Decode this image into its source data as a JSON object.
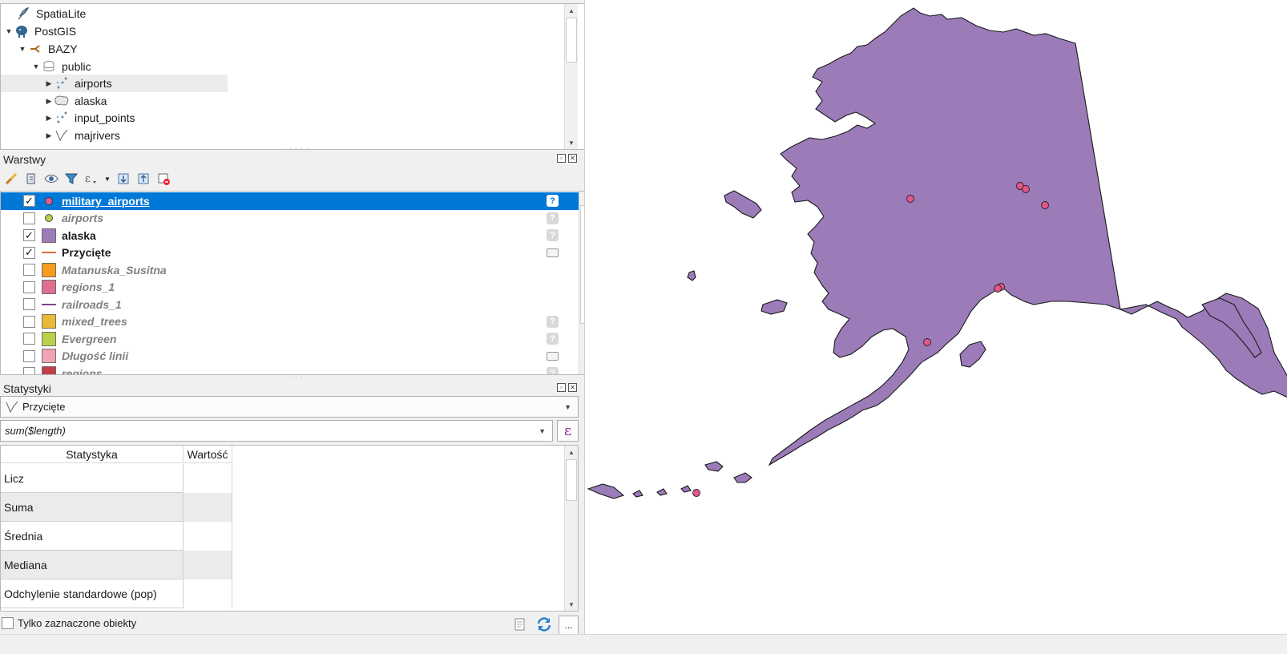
{
  "browser": {
    "items": [
      {
        "label": "SpatiaLite",
        "icon": "feather-icon"
      },
      {
        "label": "PostGIS",
        "icon": "elephant-icon"
      },
      {
        "label": "BAZY",
        "icon": "connection-icon"
      },
      {
        "label": "public",
        "icon": "database-schema-icon"
      },
      {
        "label": "airports",
        "icon": "point-layer-icon"
      },
      {
        "label": "alaska",
        "icon": "polygon-layer-icon"
      },
      {
        "label": "input_points",
        "icon": "point-layer-icon"
      },
      {
        "label": "majrivers",
        "icon": "line-layer-icon"
      }
    ]
  },
  "layers_panel": {
    "title": "Warstwy",
    "layers": [
      {
        "name": "military_airports",
        "checked": true,
        "symbol": "point",
        "color": "#e0578a",
        "visible": true,
        "indicator": "unknown-crs"
      },
      {
        "name": "airports",
        "checked": false,
        "symbol": "point",
        "color": "#b5d04a",
        "visible": false,
        "indicator": "unknown-crs"
      },
      {
        "name": "alaska",
        "checked": true,
        "symbol": "fill",
        "color": "#9b7bb8",
        "visible": true,
        "indicator": "unknown-crs"
      },
      {
        "name": "Przycięte",
        "checked": true,
        "symbol": "line",
        "color": "#e26a3a",
        "visible": true,
        "indicator": "memory"
      },
      {
        "name": "Matanuska_Susitna",
        "checked": false,
        "symbol": "fill",
        "color": "#f39c1e",
        "visible": false,
        "indicator": ""
      },
      {
        "name": "regions_1",
        "checked": false,
        "symbol": "fill",
        "color": "#e0708f",
        "visible": false,
        "indicator": ""
      },
      {
        "name": "railroads_1",
        "checked": false,
        "symbol": "line",
        "color": "#7b4a8c",
        "visible": false,
        "indicator": ""
      },
      {
        "name": "mixed_trees",
        "checked": false,
        "symbol": "fill",
        "color": "#e8b93a",
        "visible": false,
        "indicator": "unknown-crs"
      },
      {
        "name": "Evergreen",
        "checked": false,
        "symbol": "fill",
        "color": "#b7d24a",
        "visible": false,
        "indicator": "unknown-crs"
      },
      {
        "name": "Długość linii",
        "checked": false,
        "symbol": "fill",
        "color": "#f2a3b8",
        "visible": false,
        "indicator": "memory"
      },
      {
        "name": "regions",
        "checked": false,
        "symbol": "fill",
        "color": "#c0404a",
        "visible": false,
        "indicator": "unknown-crs"
      }
    ]
  },
  "stats_panel": {
    "title": "Statystyki",
    "layer_select": "Przycięte",
    "expression": "sum($length)",
    "expression_button": "ε",
    "columns": [
      "Statystyka",
      "Wartość"
    ],
    "rows": [
      {
        "stat": "Licz",
        "value": ""
      },
      {
        "stat": "Suma",
        "value": ""
      },
      {
        "stat": "Średnia",
        "value": ""
      },
      {
        "stat": "Mediana",
        "value": ""
      },
      {
        "stat": "Odchylenie standardowe (pop)",
        "value": ""
      }
    ],
    "selected_only_label": "Tylko zaznaczone obiekty",
    "more_button": "..."
  },
  "map": {
    "fill_color": "#9b7bb8",
    "point_color": "#e0578a"
  }
}
